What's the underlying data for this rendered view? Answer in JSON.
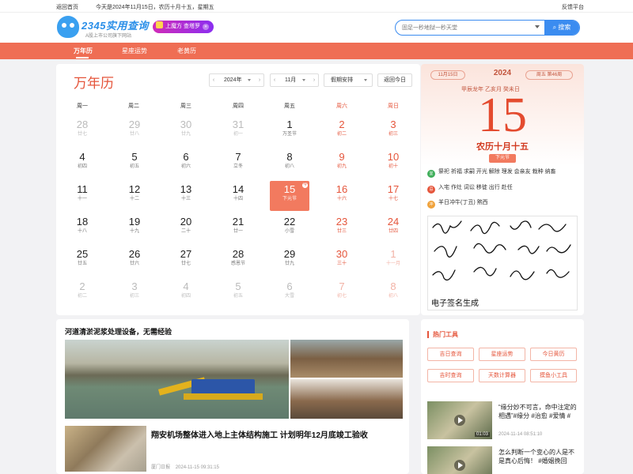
{
  "topbar": {
    "home": "返回首页",
    "date": "今天是2024年11月15日，农历十月十五，星期五",
    "feedback": "反馈平台"
  },
  "header": {
    "logo": "2345实用查询",
    "logo_sub": "A股上市公司旗下网站",
    "ad": "上魔方 查塔罗",
    "search_placeholder": "固足一秒地狱一秒天堂",
    "search_button": "搜索"
  },
  "nav": {
    "items": [
      "万年历",
      "星座运势",
      "老黄历"
    ]
  },
  "calendar": {
    "title": "万年历",
    "year": "2024年",
    "month": "11月",
    "holiday": "假期安排",
    "today_btn": "返回今日",
    "weekdays": [
      "周一",
      "周二",
      "周三",
      "周四",
      "周五",
      "周六",
      "周日"
    ],
    "weeks": [
      [
        [
          "28",
          "廿七"
        ],
        [
          "29",
          "廿八"
        ],
        [
          "30",
          "廿九"
        ],
        [
          "31",
          "初一"
        ],
        [
          "1",
          "万圣节"
        ],
        [
          "2",
          "初二"
        ],
        [
          "3",
          "初三"
        ]
      ],
      [
        [
          "4",
          "初四"
        ],
        [
          "5",
          "初五"
        ],
        [
          "6",
          "初六"
        ],
        [
          "7",
          "立冬"
        ],
        [
          "8",
          "初八"
        ],
        [
          "9",
          "初九"
        ],
        [
          "10",
          "初十"
        ]
      ],
      [
        [
          "11",
          "十一"
        ],
        [
          "12",
          "十二"
        ],
        [
          "13",
          "十三"
        ],
        [
          "14",
          "十四"
        ],
        [
          "15",
          "下元节"
        ],
        [
          "16",
          "十六"
        ],
        [
          "17",
          "十七"
        ]
      ],
      [
        [
          "18",
          "十八"
        ],
        [
          "19",
          "十九"
        ],
        [
          "20",
          "二十"
        ],
        [
          "21",
          "廿一"
        ],
        [
          "22",
          "小雪"
        ],
        [
          "23",
          "廿三"
        ],
        [
          "24",
          "廿四"
        ]
      ],
      [
        [
          "25",
          "廿五"
        ],
        [
          "26",
          "廿六"
        ],
        [
          "27",
          "廿七"
        ],
        [
          "28",
          "感恩节"
        ],
        [
          "29",
          "廿九"
        ],
        [
          "30",
          "三十"
        ],
        [
          "1",
          "十一月"
        ]
      ],
      [
        [
          "2",
          "初二"
        ],
        [
          "3",
          "初三"
        ],
        [
          "4",
          "初四"
        ],
        [
          "5",
          "初五"
        ],
        [
          "6",
          "大雪"
        ],
        [
          "7",
          "初七"
        ],
        [
          "8",
          "初八"
        ]
      ]
    ],
    "today_badge": "今"
  },
  "detail": {
    "date_l": "11月15日",
    "year": "2024",
    "date_r": "周五 第46周",
    "ganzhi": "甲辰龙年 乙亥月 癸未日",
    "day": "15",
    "lunar": "农历十月十五",
    "festival": "下元节",
    "yi_tag": "宜",
    "yi": "祭祀 祈福 求嗣 开光 解除 理发 会亲友 栽种 纳畜",
    "ji_tag": "忌",
    "ji": "入宅 作灶 词讼 移徙 出行 赴任",
    "chong_tag": "冲",
    "chong": "羊日冲牛(丁丑) 煞西",
    "sig_caption": "电子签名生成"
  },
  "news": {
    "header": "河道清淤泥浆处理设备，无需经验",
    "title2": "翔安机场整体进入地上主体结构施工 计划明年12月底竣工验收",
    "source": "厦门日报",
    "time": "2024-11-15 09:31:15"
  },
  "tools": {
    "header": "热门工具",
    "buttons": [
      "吉日查询",
      "星座运势",
      "今日黄历",
      "吉时查询",
      "天数计算器",
      "摸鱼小工具"
    ],
    "video1_title": "“缘分妙不可言，命中注定的相遇”#缘分 #治愈 #爱情 #",
    "video1_duration": "01:03",
    "video1_time": "2024-11-14 08:51:10",
    "video2_title": "怎么判断一个变心的人是不是真心后悔！ #婚姻挽回"
  },
  "colors": {
    "accent": "#ef6e54",
    "red": "#e5553b",
    "blue": "#3b8cf0"
  }
}
